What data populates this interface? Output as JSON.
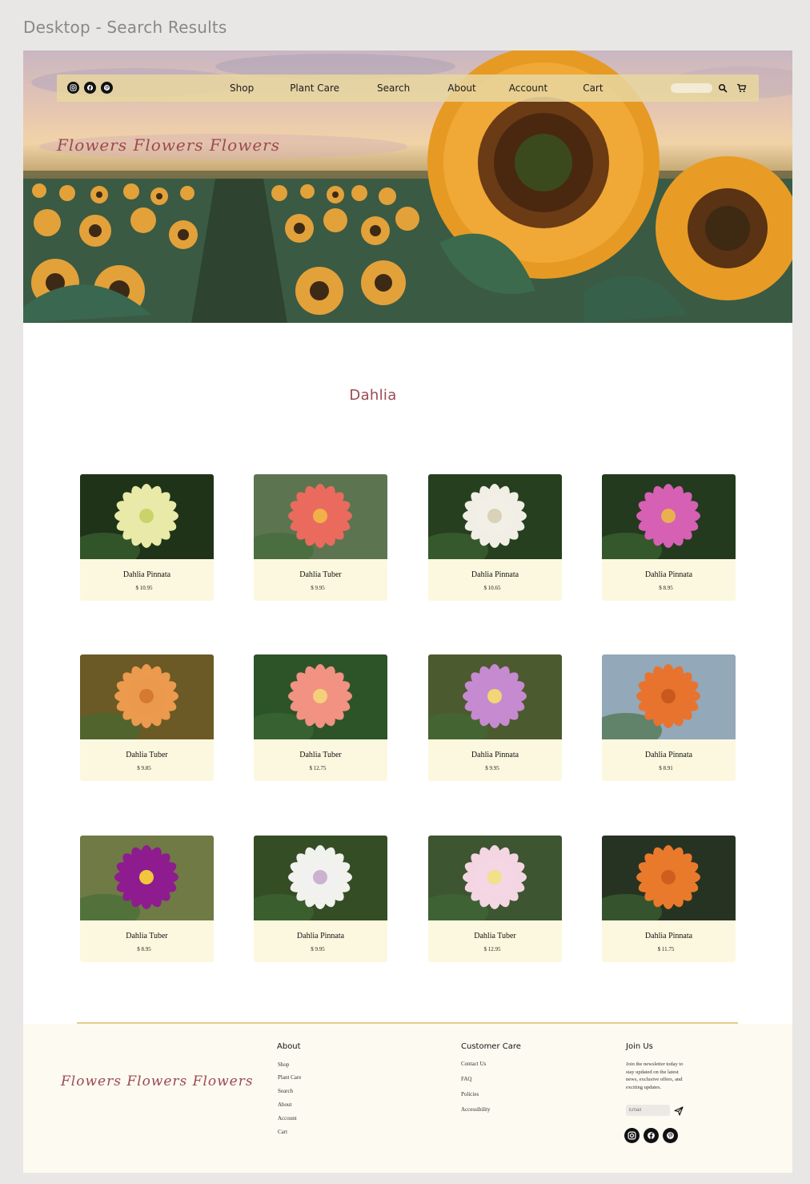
{
  "canvas": {
    "title": "Desktop - Search Results"
  },
  "header": {
    "social": [
      "instagram-icon",
      "facebook-icon",
      "pinterest-icon"
    ],
    "nav": [
      "Shop",
      "Plant Care",
      "Search",
      "About",
      "Account",
      "Cart"
    ],
    "logo": "Flowers Flowers Flowers",
    "search_placeholder": ""
  },
  "search": {
    "heading": "Dahlia"
  },
  "products": [
    {
      "name": "Dahlia Pinnata",
      "price": "$ 10.95",
      "petal": "#e9eaa8",
      "center": "#c9d36a",
      "bg": "#1f3318"
    },
    {
      "name": "Dahlia Tuber",
      "price": "$ 9.95",
      "petal": "#ea6b5e",
      "center": "#f2b048",
      "bg": "#5d7451"
    },
    {
      "name": "Dahlia Pinnata",
      "price": "$ 10.65",
      "petal": "#f1eee6",
      "center": "#d9d2b8",
      "bg": "#26401f"
    },
    {
      "name": "Dahlia Pinnata",
      "price": "$ 8.95",
      "petal": "#d660b4",
      "center": "#e9b04e",
      "bg": "#233a1e"
    },
    {
      "name": "Dahlia Tuber",
      "price": "$ 9.85",
      "petal": "#eb9a4e",
      "center": "#d57a2f",
      "bg": "#6b5a25"
    },
    {
      "name": "Dahlia Tuber",
      "price": "$ 12.75",
      "petal": "#f19282",
      "center": "#f5d07b",
      "bg": "#2c5428"
    },
    {
      "name": "Dahlia Pinnata",
      "price": "$ 9.95",
      "petal": "#c58ad0",
      "center": "#f0d675",
      "bg": "#4b5a2f"
    },
    {
      "name": "Dahlia Pinnata",
      "price": "$ 8.91",
      "petal": "#e8732e",
      "center": "#c9581d",
      "bg": "#93a8b9"
    },
    {
      "name": "Dahlia Tuber",
      "price": "$ 8.95",
      "petal": "#8e1c8f",
      "center": "#f1c63a",
      "bg": "#6f7a45"
    },
    {
      "name": "Dahlia Pinnata",
      "price": "$ 9.95",
      "petal": "#f1f1ee",
      "center": "#cbb2d0",
      "bg": "#344d25"
    },
    {
      "name": "Dahlia Tuber",
      "price": "$ 12.95",
      "petal": "#f4d6e3",
      "center": "#f2e08a",
      "bg": "#3d5531"
    },
    {
      "name": "Dahlia Pinnata",
      "price": "$ 11.75",
      "petal": "#ea7a2b",
      "center": "#cf5e1e",
      "bg": "#273322"
    }
  ],
  "footer": {
    "logo": "Flowers Flowers Flowers",
    "about": {
      "heading": "About",
      "links": [
        "Shop",
        "Plant Care",
        "Search",
        "About",
        "Account",
        "Cart"
      ]
    },
    "customer_care": {
      "heading": "Customer Care",
      "links": [
        "Contact Us",
        "FAQ",
        "Policies",
        "Accessibility"
      ]
    },
    "join": {
      "heading": "Join Us",
      "text": "Join the newsletter today to stay updated on the latest news, exclusive offers, and exciting updates.",
      "email_placeholder": "Email"
    },
    "social": [
      "instagram-icon",
      "facebook-icon",
      "pinterest-icon"
    ]
  },
  "colors": {
    "accent": "#9b4a52",
    "nav_bg": "#e8d6a0",
    "card_bg": "#fcf8df",
    "footer_bg": "#fdfaf1"
  }
}
